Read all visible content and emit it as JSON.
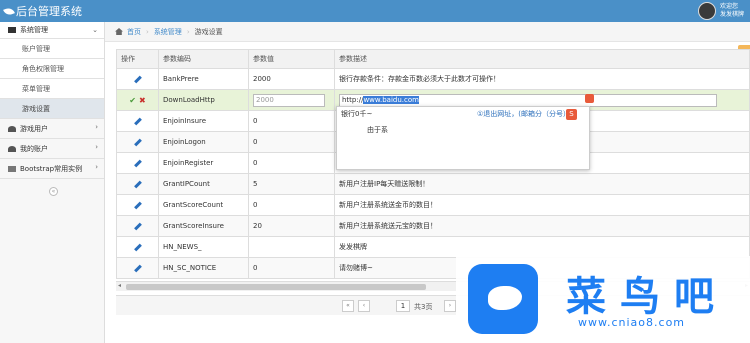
{
  "app": {
    "title": "后台管理系统"
  },
  "user": {
    "welcome": "欢迎您",
    "name": "发发棋牌"
  },
  "sidebar": {
    "groups": [
      {
        "label": "系统管理",
        "items": [
          "账户管理",
          "角色权限管理",
          "菜单管理",
          "游戏设置"
        ]
      },
      {
        "label": "游戏用户"
      },
      {
        "label": "我的账户"
      },
      {
        "label": "Bootstrap常用实例"
      }
    ],
    "collapse": "«"
  },
  "breadcrumb": {
    "home": "首页",
    "section": "系统管理",
    "page": "游戏设置"
  },
  "table": {
    "headers": [
      "操作",
      "参数编码",
      "参数值",
      "参数描述"
    ],
    "rows": [
      {
        "code": "BankPrere",
        "value": "2000",
        "desc": "银行存款条件：存款金币数必须大于此数才可操作！"
      },
      {
        "code": "DownLoadHttp",
        "value": "2000",
        "desc": "http://www.baidu.com",
        "editing": true
      },
      {
        "code": "EnjoinInsure",
        "value": "0",
        "desc": "由于系"
      },
      {
        "code": "EnjoinLogon",
        "value": "0",
        "desc": "由于系"
      },
      {
        "code": "EnjoinRegister",
        "value": "0",
        "desc": ""
      },
      {
        "code": "GrantIPCount",
        "value": "5",
        "desc": "新用户注册IP每天赠送限制！"
      },
      {
        "code": "GrantScoreCount",
        "value": "0",
        "desc": "新用户注册系统送金币的数目！"
      },
      {
        "code": "GrantScoreInsure",
        "value": "20",
        "desc": "新用户注册系统送元宝的数目！"
      },
      {
        "code": "HN_NEWS_",
        "value": "",
        "desc": "发发棋牌"
      },
      {
        "code": "HN_SC_NOTICE",
        "value": "0",
        "desc": "请勿赌博~"
      }
    ],
    "editing_desc_prefix": "http://",
    "editing_desc_selected": "www.baidu.com"
  },
  "popup": {
    "line1": "银行0千~",
    "logout": "①退出网址，(邮箱分（分号）",
    "option": "由于系"
  },
  "pager": {
    "page": "1",
    "total_label": "共3页"
  },
  "watermark": {
    "title": "菜鸟吧",
    "url": "www.cniao8.com"
  },
  "colors": {
    "topbar": "#4a90c8",
    "link": "#2a6ebb",
    "watermark": "#1e7ef2"
  }
}
